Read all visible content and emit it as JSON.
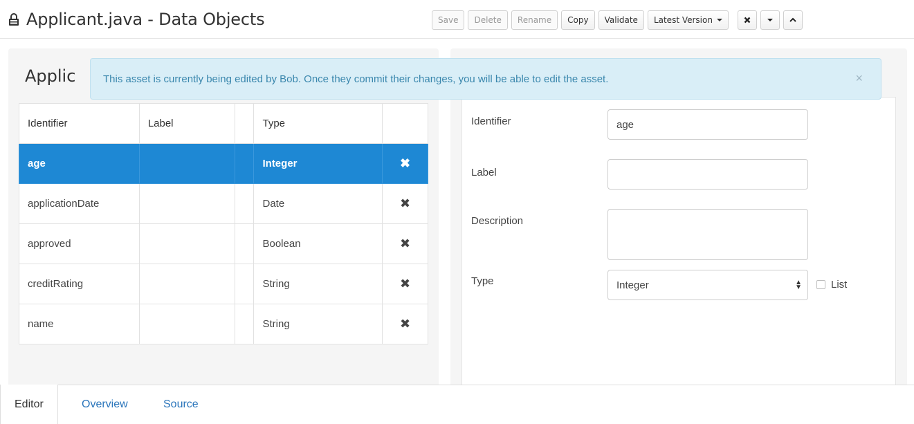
{
  "header": {
    "title": "Applicant.java - Data Objects",
    "buttons": {
      "save": "Save",
      "delete": "Delete",
      "rename": "Rename",
      "copy": "Copy",
      "validate": "Validate",
      "version": "Latest Version"
    }
  },
  "alert": {
    "message": "This asset is currently being edited by Bob. Once they commit their changes, you will be able to edit the asset.",
    "close": "×"
  },
  "left": {
    "title": "Applic",
    "columns": {
      "identifier": "Identifier",
      "label": "Label",
      "type": "Type"
    },
    "rows": [
      {
        "identifier": "age",
        "label": "",
        "type": "Integer"
      },
      {
        "identifier": "applicationDate",
        "label": "",
        "type": "Date"
      },
      {
        "identifier": "approved",
        "label": "",
        "type": "Boolean"
      },
      {
        "identifier": "creditRating",
        "label": "",
        "type": "String"
      },
      {
        "identifier": "name",
        "label": "",
        "type": "String"
      }
    ],
    "delete_glyph": "✖"
  },
  "right": {
    "identifier_label": "Identifier",
    "identifier_value": "age",
    "label_label": "Label",
    "label_value": "",
    "description_label": "Description",
    "description_value": "",
    "type_label": "Type",
    "type_value": "Integer",
    "list_label": "List"
  },
  "tabs": {
    "editor": "Editor",
    "overview": "Overview",
    "source": "Source"
  },
  "colors": {
    "selected_row": "#1e88d4",
    "alert_bg": "#d9eef7",
    "alert_text": "#3a87ad",
    "link": "#2a75bb"
  },
  "icons": {
    "lock": "lock-icon",
    "close": "close-icon",
    "chevron_down": "chevron-down-icon",
    "chevron_up": "chevron-up-icon",
    "delete": "delete-icon"
  }
}
